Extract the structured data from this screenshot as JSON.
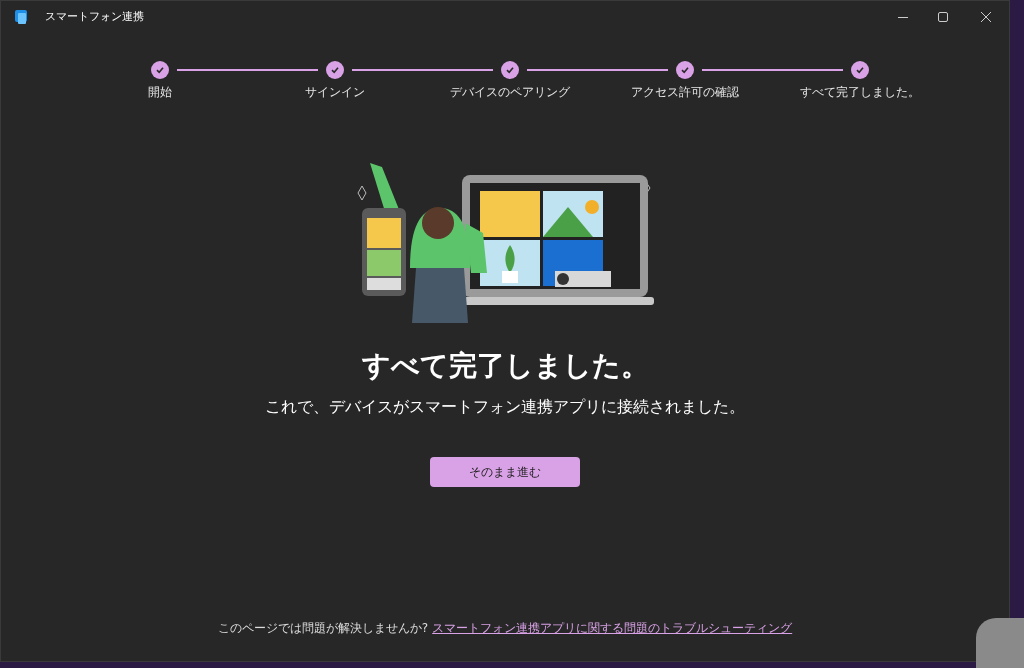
{
  "window": {
    "title": "スマートフォン連携"
  },
  "steps": [
    {
      "label": "開始",
      "done": true
    },
    {
      "label": "サインイン",
      "done": true
    },
    {
      "label": "デバイスのペアリング",
      "done": true
    },
    {
      "label": "アクセス許可の確認",
      "done": true
    },
    {
      "label": "すべて完了しました。",
      "done": true
    }
  ],
  "heading": "すべて完了しました。",
  "message": "これで、デバイスがスマートフォン連携アプリに接続されました。",
  "continue_button": "そのまま進む",
  "footer": {
    "text": "このページでは問題が解決しませんか?",
    "link": "スマートフォン連携アプリに関する問題のトラブルシューティング"
  }
}
